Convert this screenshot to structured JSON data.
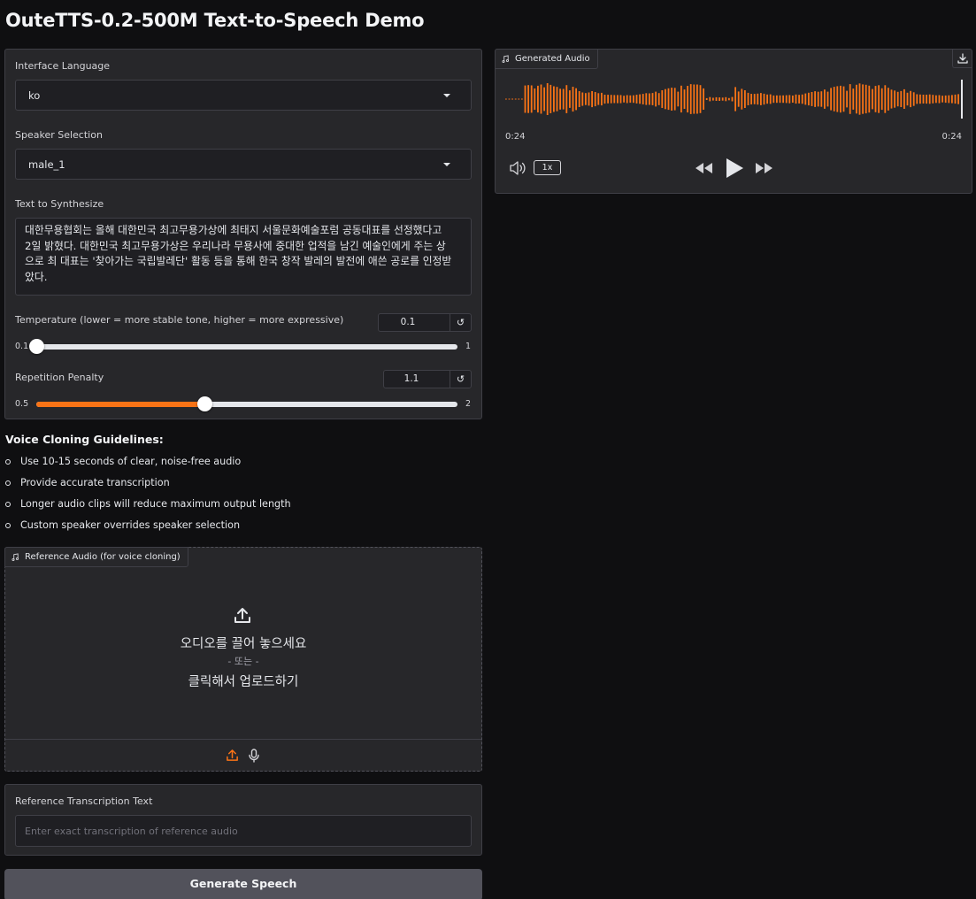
{
  "app": {
    "title": "OuteTTS-0.2-500M Text-to-Speech Demo"
  },
  "settings": {
    "interface_language": {
      "label": "Interface Language",
      "value": "ko"
    },
    "speaker": {
      "label": "Speaker Selection",
      "value": "male_1"
    },
    "text": {
      "label": "Text to Synthesize",
      "lines": [
        "대한무용협회는 올해 대한민국 최고무용가상에 최태지 서울문화예술포럼 공동대표를 선정했다고",
        "2일 밝혔다. 대한민국 최고무용가상은 우리나라 무용사에 중대한 업적을 남긴 예술인에게 주는 상",
        "으로 최 대표는 '찾아가는 국립발레단' 활동 등을 통해 한국 창작 발레의 발전에 애쓴 공로를 인정받",
        "았다."
      ]
    },
    "temperature": {
      "label": "Temperature (lower = more stable tone, higher = more expressive)",
      "value": "0.1",
      "min": "0.1",
      "max": "1",
      "fraction": 0.0
    },
    "repetition_penalty": {
      "label": "Repetition Penalty",
      "value": "1.1",
      "min": "0.5",
      "max": "2",
      "fraction": 0.4
    }
  },
  "guidelines": {
    "title": "Voice Cloning Guidelines:",
    "items": [
      "Use 10-15 seconds of clear, noise-free audio",
      "Provide accurate transcription",
      "Longer audio clips will reduce maximum output length",
      "Custom speaker overrides speaker selection"
    ]
  },
  "reference_audio": {
    "label": "Reference Audio (for voice cloning)",
    "drop_text": "오디오를 끌어 놓으세요",
    "or_text": "- 또는 -",
    "click_text": "클릭해서 업로드하기"
  },
  "reference_text": {
    "label": "Reference Transcription Text",
    "placeholder": "Enter exact transcription of reference audio"
  },
  "generate_button": "Generate Speech",
  "output": {
    "label": "Generated Audio",
    "current_time": "0:24",
    "duration": "0:24",
    "speed": "1x",
    "accent_color": "#f97316"
  }
}
